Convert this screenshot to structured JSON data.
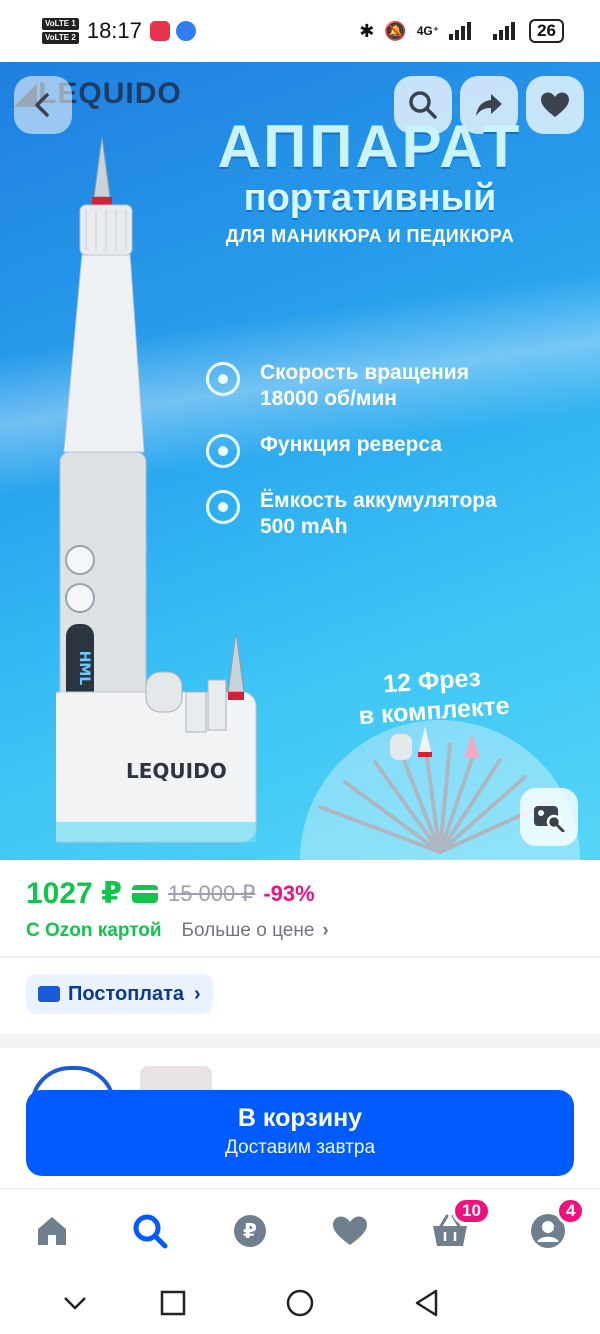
{
  "status_bar": {
    "volte1": "VoLTE 1",
    "volte2": "VoLTE 2",
    "time": "18:17",
    "network": "4G⁺",
    "battery": "26"
  },
  "hero": {
    "brand": "LEQUIDO",
    "base_brand": "LEQUIDO",
    "title_line1": "АППАРАТ",
    "title_line2": "портативный",
    "subtitle": "ДЛЯ МАНИКЮРА И ПЕДИКЮРА",
    "features": [
      {
        "line1": "Скорость вращения",
        "line2": "18000 об/мин"
      },
      {
        "line1": "Функция реверса",
        "line2": ""
      },
      {
        "line1": "Ёмкость аккумулятора",
        "line2": "500 mAh"
      }
    ],
    "bits_line1": "12 Фрез",
    "bits_line2": "в комплекте",
    "device_letters": "HML"
  },
  "price": {
    "current": "1027 ₽",
    "old": "15 000 ₽",
    "discount": "-93%",
    "ozon_card": "С Ozon картой",
    "more": "Больше о цене",
    "chevron": "›"
  },
  "postpay": {
    "label": "Постоплата",
    "chevron": "›"
  },
  "cart_button": {
    "title": "В корзину",
    "subtitle": "Доставим завтра"
  },
  "bottom_nav": {
    "cart_badge": "10",
    "profile_badge": "4"
  },
  "colors": {
    "accent": "#005bff",
    "price_green": "#10c44c",
    "discount_pink": "#f1117e"
  }
}
